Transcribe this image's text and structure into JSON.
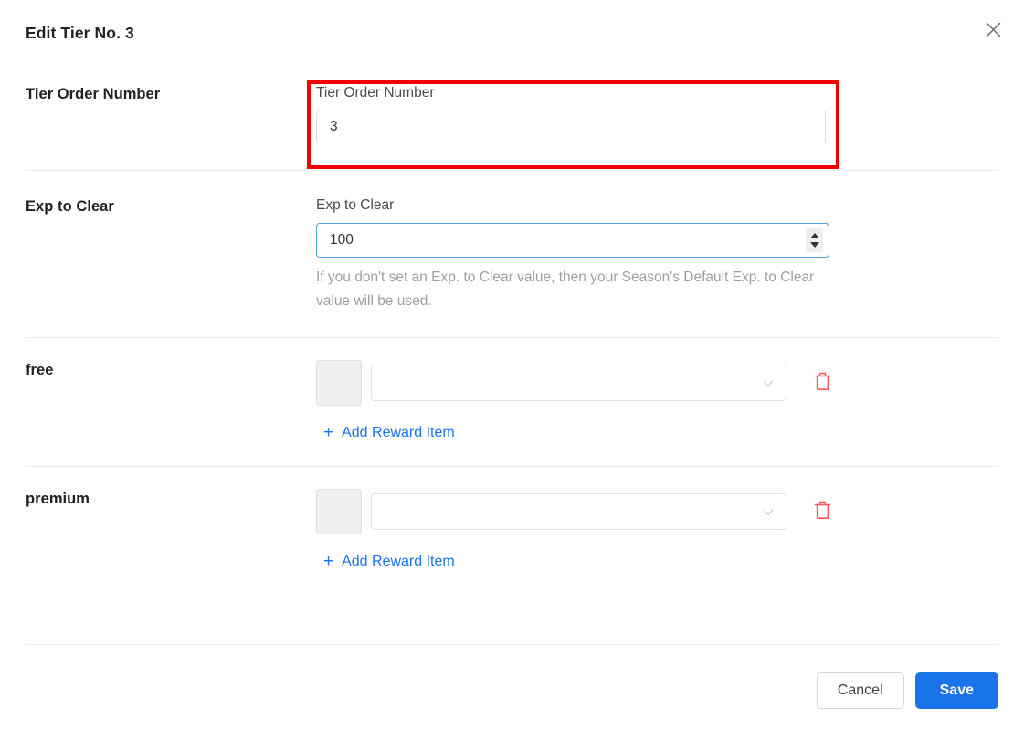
{
  "dialog": {
    "title": "Edit Tier No. 3",
    "close_icon": "close-icon"
  },
  "highlight_color": "#f20000",
  "accent_color": "#1a73e8",
  "danger_color": "#f9595f",
  "rows": {
    "tier_order": {
      "label": "Tier Order Number",
      "field_caption": "Tier Order Number",
      "value": "3",
      "placeholder": "Tier Order Number",
      "highlighted": true
    },
    "exp_to_clear": {
      "label": "Exp to Clear",
      "field_caption": "Exp to Clear",
      "value": "100",
      "placeholder": "Exp to Clear",
      "help_text": "If you don't set an Exp. to Clear value, then your Season's Default Exp. to Clear value will be used.",
      "spinner_up_icon": "spinner-up-icon",
      "spinner_down_icon": "spinner-down-icon"
    },
    "free": {
      "label": "free",
      "reward": {
        "thumbnail": "",
        "select_value": "",
        "select_placeholder": "",
        "chevron_icon": "chevron-down-icon",
        "delete_icon": "trash-icon"
      },
      "add_label": "Add Reward Item",
      "add_icon": "plus-icon"
    },
    "premium": {
      "label": "premium",
      "reward": {
        "thumbnail": "",
        "select_value": "",
        "select_placeholder": "",
        "chevron_icon": "chevron-down-icon",
        "delete_icon": "trash-icon"
      },
      "add_label": "Add Reward Item",
      "add_icon": "plus-icon"
    }
  },
  "footer": {
    "cancel_label": "Cancel",
    "save_label": "Save"
  }
}
